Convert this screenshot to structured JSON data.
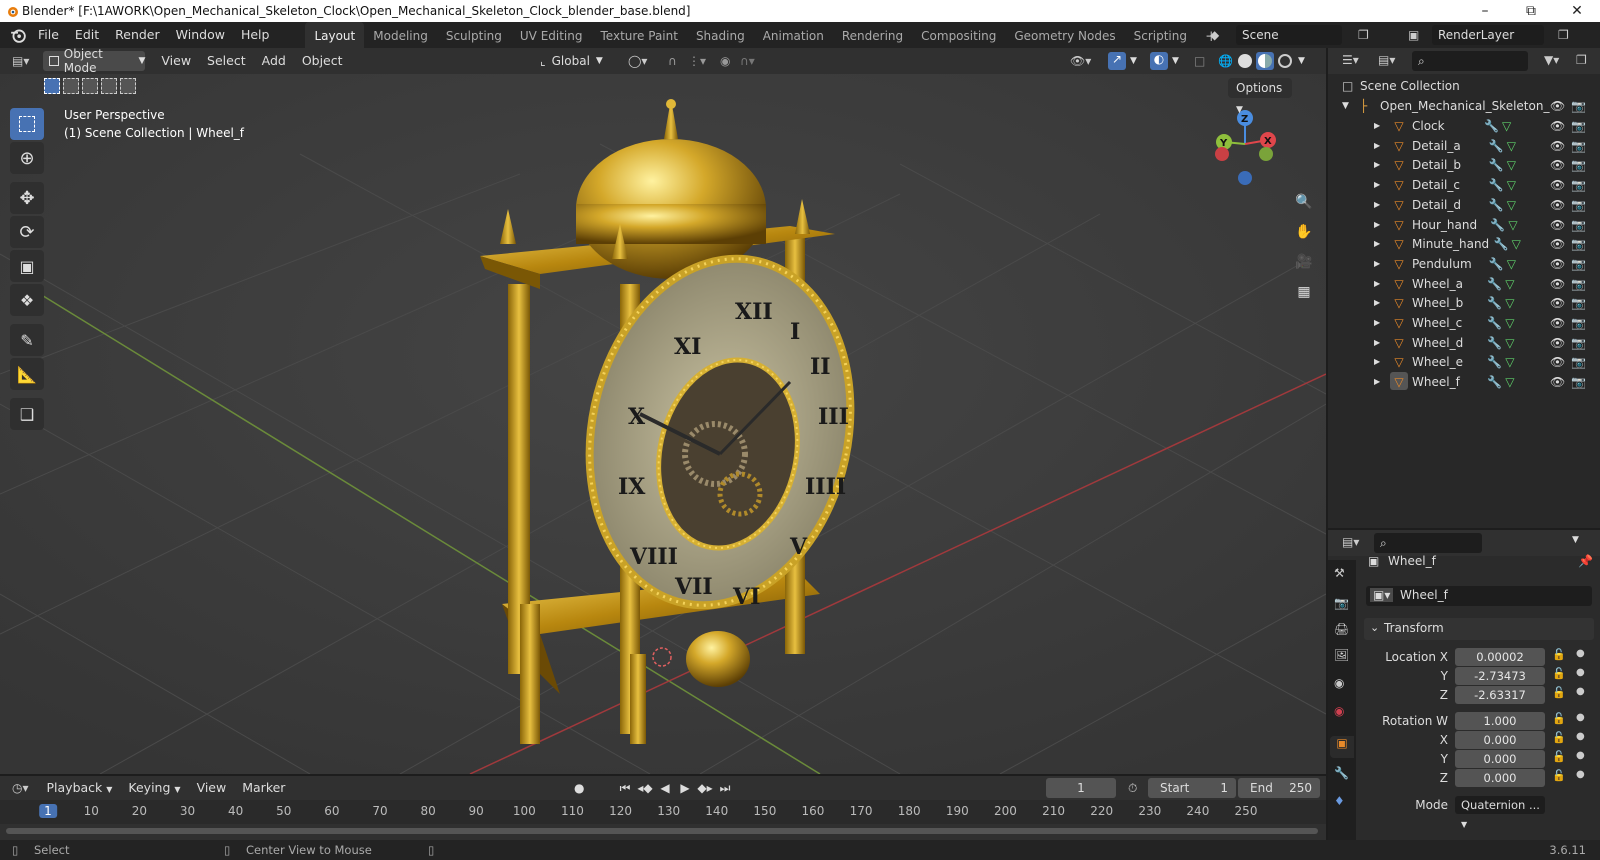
{
  "window": {
    "title": "Blender* [F:\\1AWORK\\Open_Mechanical_Skeleton_Clock\\Open_Mechanical_Skeleton_Clock_blender_base.blend]"
  },
  "menubar": [
    "File",
    "Edit",
    "Render",
    "Window",
    "Help"
  ],
  "workspaces": [
    "Layout",
    "Modeling",
    "Sculpting",
    "UV Editing",
    "Texture Paint",
    "Shading",
    "Animation",
    "Rendering",
    "Compositing",
    "Geometry Nodes",
    "Scripting"
  ],
  "scene": "Scene",
  "renderlayer": "RenderLayer",
  "viewport_header": {
    "mode": "Object Mode",
    "menus": [
      "View",
      "Select",
      "Add",
      "Object"
    ],
    "orientation": "Global",
    "options": "Options"
  },
  "viewport": {
    "perspective": "User Perspective",
    "collection_line": "(1) Scene Collection | Wheel_f"
  },
  "outliner": {
    "root": "Scene Collection",
    "collection": "Open_Mechanical_Skeleton_",
    "objects": [
      "Clock",
      "Detail_a",
      "Detail_b",
      "Detail_c",
      "Detail_d",
      "Hour_hand",
      "Minute_hand",
      "Pendulum",
      "Wheel_a",
      "Wheel_b",
      "Wheel_c",
      "Wheel_d",
      "Wheel_e",
      "Wheel_f"
    ],
    "selected": "Wheel_f"
  },
  "properties": {
    "object_name": "Wheel_f",
    "data_name": "Wheel_f",
    "panel": "Transform",
    "location": {
      "label": "Location X",
      "x": "0.00002",
      "y": "-2.73473",
      "z": "-2.63317"
    },
    "rotation": {
      "label": "Rotation W",
      "w": "1.000",
      "x": "0.000",
      "y": "0.000",
      "z": "0.000"
    },
    "axis": {
      "x": "X",
      "y": "Y",
      "z": "Z"
    },
    "mode_label": "Mode",
    "mode_value": "Quaternion ..."
  },
  "timeline": {
    "menus": [
      "Playback",
      "Keying",
      "View",
      "Marker"
    ],
    "current_frame": "1",
    "start_label": "Start",
    "start": "1",
    "end_label": "End",
    "end": "250",
    "ruler": [
      "1",
      "10",
      "20",
      "30",
      "40",
      "50",
      "60",
      "70",
      "80",
      "90",
      "100",
      "110",
      "120",
      "130",
      "140",
      "150",
      "160",
      "170",
      "180",
      "190",
      "200",
      "210",
      "220",
      "230",
      "240",
      "250"
    ]
  },
  "statusbar": {
    "select": "Select",
    "center": "Center View to Mouse",
    "version": "3.6.11"
  },
  "colors": {
    "accent": "#4772b3",
    "gold": "#c9a227",
    "x_axis": "#e0464b",
    "y_axis": "#8fbf3c",
    "z_axis": "#4a8de0"
  }
}
